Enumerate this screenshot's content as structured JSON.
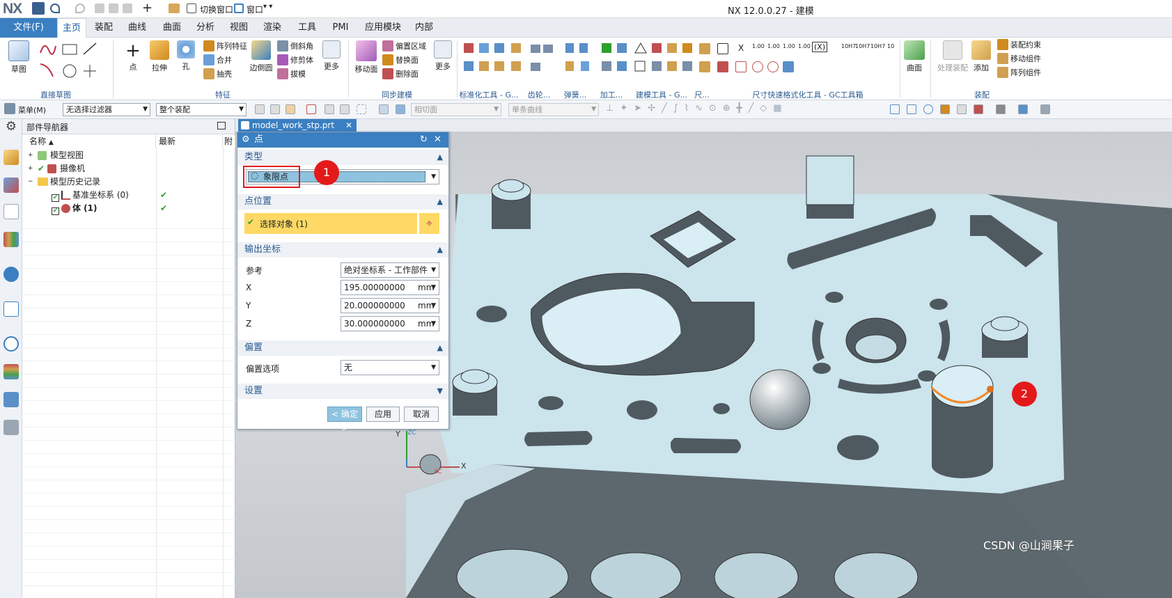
{
  "app": {
    "logo": "NX",
    "window_title": "NX 12.0.0.27 - 建模",
    "switch_window": "切换窗口",
    "window_menu": "窗口"
  },
  "ribbon_tabs": [
    "主页",
    "装配",
    "曲线",
    "曲面",
    "分析",
    "视图",
    "渲染",
    "工具",
    "PMI",
    "应用模块",
    "内部"
  ],
  "file_tab": "文件(F)",
  "ribbon": {
    "sketch": "草图",
    "point": "点",
    "extrude": "拉伸",
    "hole": "孔",
    "pattern_feature": "阵列特征",
    "unite": "合并",
    "shell": "抽壳",
    "edge_blend": "边倒圆",
    "chamfer": "倒斜角",
    "trim_body": "修剪体",
    "draft": "拔模",
    "more1": "更多",
    "move_face": "移动面",
    "offset_region": "偏置区域",
    "replace_face": "替换面",
    "delete_face": "删除面",
    "more2": "更多",
    "surface": "曲面",
    "process_assembly": "处理装配",
    "add": "添加",
    "assembly_constraint": "装配约束",
    "move_component": "移动组件",
    "pattern_component": "阵列组件",
    "groups": {
      "direct_sketch": "直接草图",
      "feature": "特征",
      "sync_modeling": "同步建模",
      "standard_tools": "标准化工具 - G...",
      "gear": "齿轮...",
      "spring": "弹簧...",
      "machining": "加工...",
      "modeling_tools": "建模工具 - G...",
      "dim": "尺...",
      "dim_format": "尺寸快速格式化工具 - GC工具箱",
      "assembly": "装配"
    },
    "fmt_labels": [
      "X",
      "1.00",
      "1.00",
      "1.00",
      "1.00",
      "(X)",
      "10H7",
      "10H7",
      "10H7",
      "10"
    ]
  },
  "cmdbar": {
    "menu": "菜单(M)",
    "filter": "无选择过滤器",
    "assembly_scope": "整个装配",
    "tangent_face": "相切面",
    "single_curve": "单条曲线"
  },
  "navigator": {
    "title": "部件导航器",
    "col_name": "名称",
    "col_latest": "最新",
    "col_extra": "附",
    "items": [
      {
        "label": "模型视图",
        "latest": ""
      },
      {
        "label": "摄像机",
        "latest": ""
      },
      {
        "label": "模型历史记录",
        "latest": ""
      },
      {
        "label": "基准坐标系 (0)",
        "latest": "✔"
      },
      {
        "label": "体 (1)",
        "latest": "✔"
      }
    ]
  },
  "doc_tab": "model_work_stp.prt",
  "dialog": {
    "title": "点",
    "type_section": "类型",
    "type_value": "象限点",
    "point_location_section": "点位置",
    "select_object": "选择对象 (1)",
    "output_coords_section": "输出坐标",
    "reference_label": "参考",
    "reference_value": "绝对坐标系 - 工作部件",
    "x_label": "X",
    "x_value": "195.00000000",
    "y_label": "Y",
    "y_value": "20.000000000",
    "z_label": "Z",
    "z_value": "30.000000000",
    "unit": "mm",
    "offset_section": "偏置",
    "offset_option_label": "偏置选项",
    "offset_option_value": "无",
    "settings_section": "设置",
    "ok": "< 确定 >",
    "apply": "应用",
    "cancel": "取消"
  },
  "annotations": {
    "badge1": "1",
    "badge2": "2"
  },
  "triad": {
    "x": "X",
    "y": "Y",
    "zc": "ZC",
    "xc": "XC"
  },
  "watermark": "CSDN @山涧果子",
  "colors": {
    "accent": "#3a7fc1",
    "highlight_row": "#ffd966",
    "badge": "#e41a1a",
    "part": "#c9e2ea"
  }
}
